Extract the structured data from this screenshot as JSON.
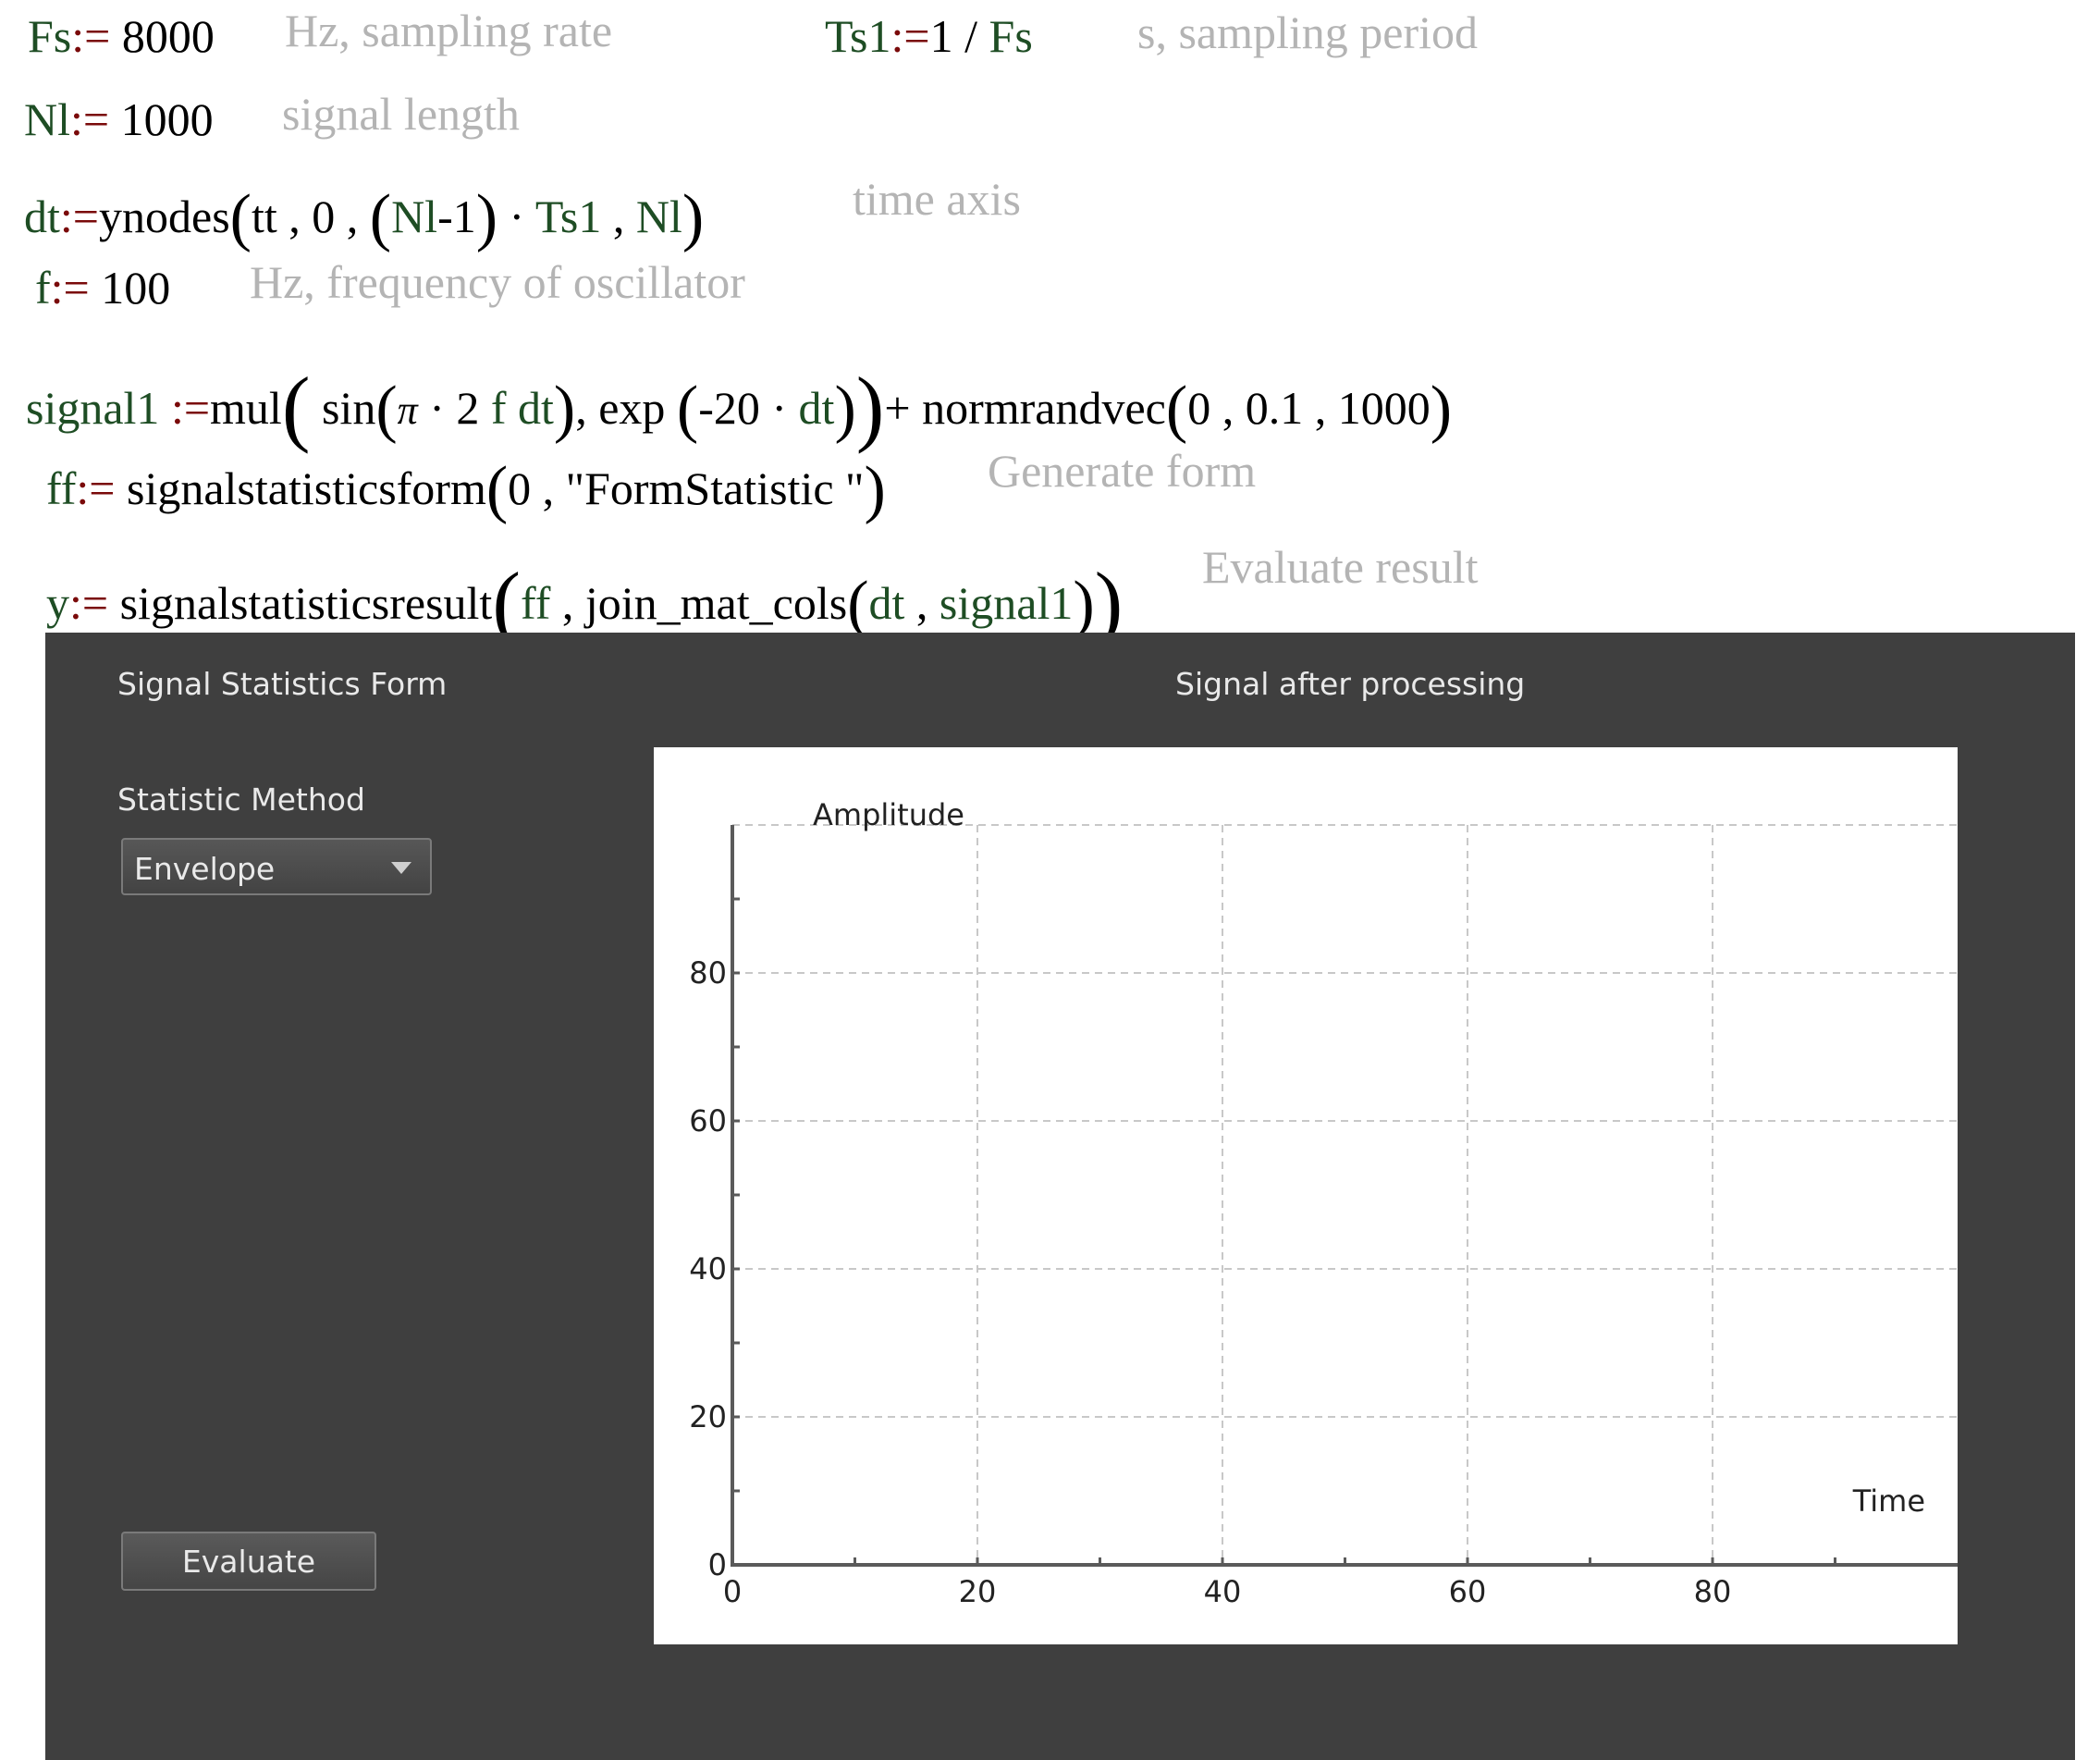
{
  "worksheet": {
    "line1": {
      "fs_var": "Fs",
      "fs_assign": ":=",
      "fs_value": "8000",
      "fs_comment": "Hz, sampling rate",
      "ts_var": "Ts1",
      "ts_assign": ":=",
      "ts_num": "1",
      "ts_div": "/",
      "ts_den": "Fs",
      "ts_comment": "s, sampling period"
    },
    "line2": {
      "var": "Nl",
      "assign": ":=",
      "value": "1000",
      "comment": "signal length"
    },
    "line3": {
      "var": "dt",
      "assign": ":=",
      "func": "ynodes",
      "open": "(",
      "arg1": "tt",
      "sep1": ",",
      "arg2": "0",
      "sep2": ",",
      "inner_open": "(",
      "inner_nl": "Nl",
      "minus": "-",
      "one": "1",
      "inner_close": ")",
      "times": "·",
      "ts": "Ts1",
      "sep3": ",",
      "arg4": "Nl",
      "close": ")",
      "comment": "time axis"
    },
    "line4": {
      "var": "f",
      "assign": ":=",
      "value": "100",
      "comment": "Hz, frequency of oscillator"
    },
    "line5": {
      "var": "signal1",
      "assign": ":=",
      "func": "mul",
      "open": "(",
      "sin": "sin",
      "sin_open": "(",
      "pi": "π",
      "times1": "·",
      "two": "2",
      "f": "f",
      "dt": "dt",
      "sin_close": ")",
      "sep": ",",
      "exp": "exp",
      "exp_open": "(",
      "neg20": "-20",
      "times2": "·",
      "exp_dt": "dt",
      "exp_close": ")",
      "close": ")",
      "plus": "+",
      "normrandvec": "normrandvec",
      "nr_open": "(",
      "nr_a": "0",
      "nr_sep1": ",",
      "nr_b": "0.1",
      "nr_sep2": ",",
      "nr_c": "1000",
      "nr_close": ")"
    },
    "line6": {
      "var": "ff",
      "assign": ":=",
      "func": "signalstatisticsform",
      "open": "(",
      "arg1": "0",
      "sep": ",",
      "arg2": "\"FormStatistic \"",
      "close": ")",
      "comment": "Generate form"
    },
    "line7": {
      "var": "y",
      "assign": ":=",
      "func": "signalstatisticsresult",
      "open": "(",
      "arg1": "ff",
      "sep": ",",
      "inner_func": "join_mat_cols",
      "inner_open": "(",
      "inner_a": "dt",
      "inner_sep": ",",
      "inner_b": "signal1",
      "inner_close": ")",
      "close": ")",
      "comment": "Evaluate result"
    }
  },
  "form": {
    "title": "Signal Statistics Form",
    "plot_title": "Signal after processing",
    "method_label": "Statistic Method",
    "method_selected": "Envelope",
    "evaluate_label": "Evaluate"
  },
  "colors": {
    "variable": "#1e4d24",
    "operator": "#7a0a0a",
    "comment": "#b4b4b4",
    "form_background": "#3f3f3f",
    "grid": "#c8c8c8"
  },
  "chart_data": {
    "type": "line",
    "series": [],
    "xlabel": "Time",
    "ylabel": "Amplitude",
    "xlim": [
      0,
      100
    ],
    "ylim": [
      0,
      100
    ],
    "xticks": [
      0,
      20,
      40,
      60,
      80
    ],
    "yticks": [
      0,
      20,
      40,
      60,
      80
    ],
    "xtick_labels": [
      "0",
      "20",
      "40",
      "60",
      "80"
    ],
    "ytick_labels": [
      "0",
      "20",
      "40",
      "60",
      "80"
    ],
    "grid": true
  }
}
